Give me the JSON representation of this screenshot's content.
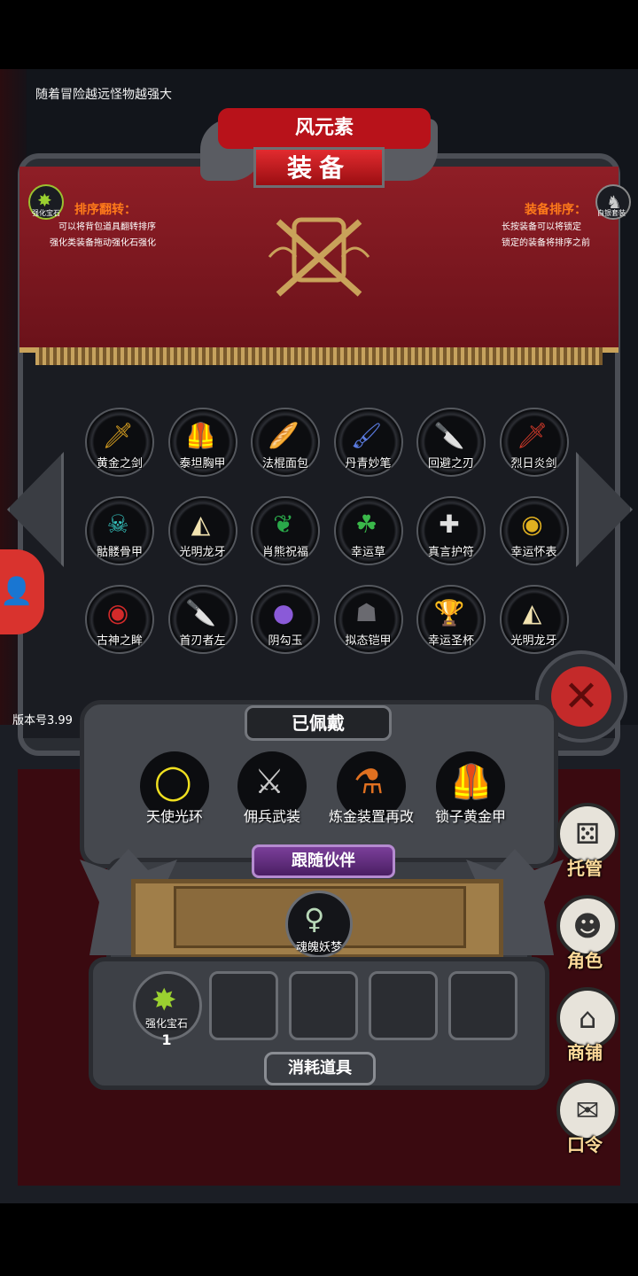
{
  "hint_text": "随着冒险越远怪物越强大",
  "header": {
    "top_label": "风元素",
    "title": "装备"
  },
  "corners": {
    "left_item": "强化宝石",
    "right_item": "白银套装"
  },
  "sort_flip": {
    "title": "排序翻转：",
    "line1": "可以将背包道具翻转排序",
    "line2": "强化类装备拖动强化石强化"
  },
  "equip_sort": {
    "title": "装备排序：",
    "line1": "长按装备可以将锁定",
    "line2": "锁定的装备将排序之前"
  },
  "inventory": [
    {
      "label": "黄金之剑",
      "icon": "golden-sword",
      "glyph": "🗡",
      "color": "#d9a020"
    },
    {
      "label": "泰坦胸甲",
      "icon": "titan-chestplate",
      "glyph": "🦺",
      "color": "#c9782a"
    },
    {
      "label": "法棍面包",
      "icon": "baguette",
      "glyph": "🥖",
      "color": "#d27a2a"
    },
    {
      "label": "丹青妙笔",
      "icon": "magic-brush",
      "glyph": "🖌",
      "color": "#5a7be0"
    },
    {
      "label": "回避之刃",
      "icon": "evasion-blade",
      "glyph": "🔪",
      "color": "#dcdcdc"
    },
    {
      "label": "烈日炎剑",
      "icon": "sun-flame-sword",
      "glyph": "🗡",
      "color": "#d23a2a"
    },
    {
      "label": "骷髅骨甲",
      "icon": "skeleton-armor",
      "glyph": "☠",
      "color": "#36c6c0"
    },
    {
      "label": "光明龙牙",
      "icon": "light-dragon-fang",
      "glyph": "◭",
      "color": "#f2e3b0"
    },
    {
      "label": "肖熊祝福",
      "icon": "bear-blessing-amulet",
      "glyph": "❦",
      "color": "#2aa84a"
    },
    {
      "label": "幸运草",
      "icon": "lucky-clover",
      "glyph": "☘",
      "color": "#3ab84a"
    },
    {
      "label": "真言护符",
      "icon": "truth-amulet",
      "glyph": "✚",
      "color": "#e0e0e0"
    },
    {
      "label": "幸运怀表",
      "icon": "lucky-pocket-watch",
      "glyph": "◉",
      "color": "#e0b020"
    },
    {
      "label": "古神之眸",
      "icon": "ancient-god-eye",
      "glyph": "◉",
      "color": "#d22a2a"
    },
    {
      "label": "首刃者左",
      "icon": "first-blade-left",
      "glyph": "🔪",
      "color": "#e8c8c8"
    },
    {
      "label": "阴勾玉",
      "icon": "yin-magatama",
      "glyph": "●",
      "color": "#8a5ad8"
    },
    {
      "label": "拟态铠甲",
      "icon": "mimic-armor",
      "glyph": "☗",
      "color": "#6a6a70"
    },
    {
      "label": "幸运圣杯",
      "icon": "lucky-chalice",
      "glyph": "🏆",
      "color": "#f0f0f0"
    },
    {
      "label": "光明龙牙",
      "icon": "light-dragon-fang",
      "glyph": "◭",
      "color": "#f2e3b0"
    }
  ],
  "version": "版本号3.99",
  "equipped": {
    "title": "已佩戴",
    "items": [
      {
        "label": "天使光环",
        "icon": "angel-halo",
        "glyph": "◯",
        "color": "#f0e020"
      },
      {
        "label": "佣兵武装",
        "icon": "mercenary-armor",
        "glyph": "⚔",
        "color": "#c8c8c8"
      },
      {
        "label": "炼金装置再改",
        "icon": "alchemy-device",
        "glyph": "⚗",
        "color": "#e07020"
      },
      {
        "label": "锁子黄金甲",
        "icon": "golden-chainmail",
        "glyph": "🦺",
        "color": "#c8502a"
      }
    ]
  },
  "companion": {
    "title": "跟随伙伴",
    "name": "魂魄妖梦"
  },
  "consumables": {
    "title": "消耗道具",
    "item_label": "强化宝石",
    "item_count": "1"
  },
  "side_menu": [
    {
      "label": "托管",
      "icon": "dice-icon",
      "glyph": "⚄"
    },
    {
      "label": "角色",
      "icon": "hooded-figure-icon",
      "glyph": "☻"
    },
    {
      "label": "商铺",
      "icon": "shop-icon",
      "glyph": "⌂"
    },
    {
      "label": "口令",
      "icon": "scroll-icon",
      "glyph": "✉"
    }
  ],
  "colors": {
    "banner_red": "#8f1e26",
    "accent_orange": "#ff7a1a",
    "close_red": "#c42a2a",
    "follow_purple": "#7b3f9a"
  }
}
